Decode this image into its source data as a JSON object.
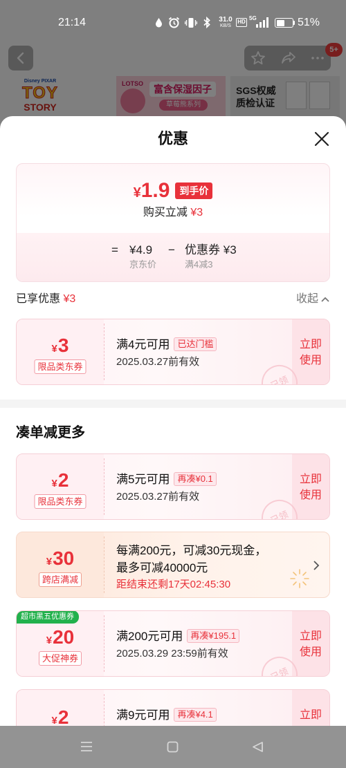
{
  "status_bar": {
    "time": "21:14",
    "net_speed": "31.0",
    "net_unit": "KB/S",
    "hd": "HD",
    "network": "5G",
    "battery": "51%"
  },
  "page_header": {
    "notification_badge": "5+"
  },
  "product_images": {
    "left": {
      "brand": "Disney PIXAR",
      "title_line1": "TOY",
      "title_line2": "STORY"
    },
    "middle": {
      "brand": "LOTSO",
      "headline": "富含保湿因子",
      "series": "草莓熊系列"
    },
    "right": {
      "line1": "SGS权威",
      "line2": "质检认证"
    }
  },
  "sheet": {
    "title": "优惠"
  },
  "summary": {
    "currency": "¥",
    "final_price": "1.9",
    "final_label": "到手价",
    "reduce_label": "购买立减",
    "reduce_value": "¥3",
    "equals": "=",
    "jd_price": "¥4.9",
    "jd_label": "京东价",
    "minus": "−",
    "coupon_label": "优惠券",
    "coupon_value": "¥3",
    "coupon_rule": "满4减3"
  },
  "enjoyed": {
    "label": "已享优惠",
    "value": "¥3",
    "toggle": "收起"
  },
  "applied_coupon": {
    "currency": "¥",
    "amount": "3",
    "type": "限品类东券",
    "condition": "满4元可用",
    "status": "已达门槛",
    "validity": "2025.03.27前有效",
    "action_line1": "立即",
    "action_line2": "使用",
    "stamp": "已领"
  },
  "more_section": {
    "title": "凑单减更多"
  },
  "coupons": [
    {
      "currency": "¥",
      "amount": "2",
      "type": "限品类东券",
      "condition": "满5元可用",
      "status": "再凑¥0.1",
      "validity": "2025.03.27前有效",
      "action_line1": "立即",
      "action_line2": "使用",
      "stamp": "已领"
    },
    {
      "currency": "¥",
      "amount": "30",
      "type": "跨店满减",
      "line1": "每满200元，可减30元现金，",
      "line2": "最多可减40000元",
      "countdown": "距结束还剩17天02:45:30"
    },
    {
      "badge": "超市黑五优惠券",
      "currency": "¥",
      "amount": "20",
      "type": "大促神券",
      "condition": "满200元可用",
      "status": "再凑¥195.1",
      "validity": "2025.03.29 23:59前有效",
      "action_line1": "立即",
      "action_line2": "使用",
      "stamp": "已领"
    },
    {
      "currency": "¥",
      "amount": "2",
      "condition": "满9元可用",
      "status": "再凑¥4.1",
      "action_line1": "立即"
    }
  ],
  "colors": {
    "accent": "#e8313a",
    "promo_badge": "#22b14c",
    "countdown": "#e8313a"
  },
  "icons": [
    "drop-icon",
    "alarm-icon",
    "vibrate-icon",
    "bluetooth-icon",
    "signal-icon",
    "battery-icon",
    "back-icon",
    "star-icon",
    "share-icon",
    "more-icon",
    "close-icon",
    "chevron-up-icon",
    "chevron-right-icon",
    "menu-icon",
    "home-icon",
    "nav-back-icon"
  ]
}
